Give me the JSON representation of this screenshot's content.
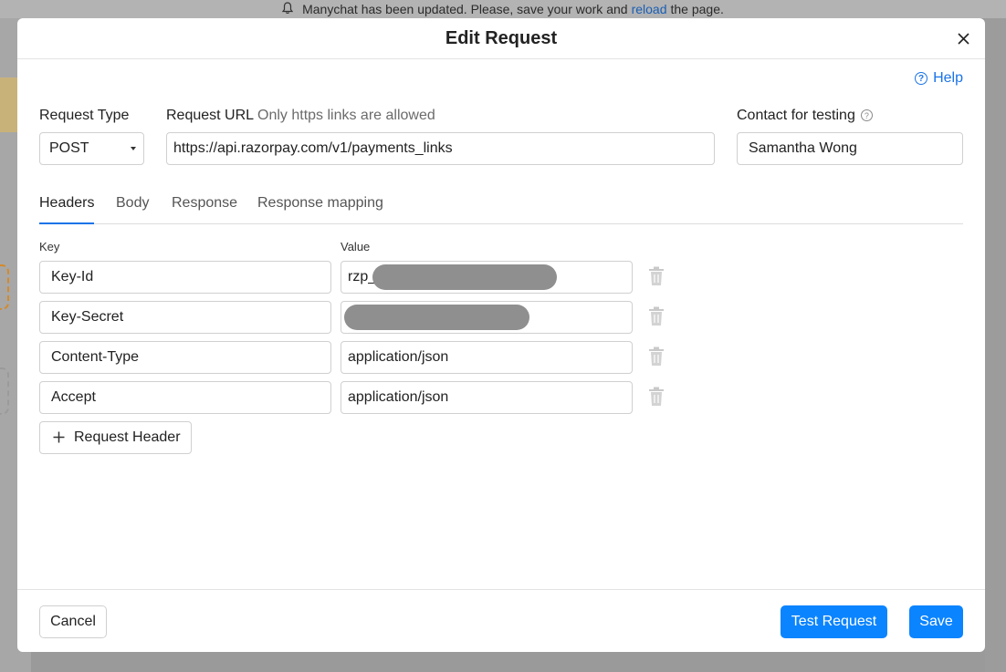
{
  "background": {
    "banner": {
      "text_before": "Manychat has been updated. Please, save your work and",
      "link": "reload",
      "text_after": "the page."
    }
  },
  "modal": {
    "title": "Edit Request",
    "help_label": "Help",
    "request_type": {
      "label": "Request Type",
      "value": "POST"
    },
    "request_url": {
      "label": "Request URL",
      "hint": "Only https links are allowed",
      "value": "https://api.razorpay.com/v1/payments_links"
    },
    "contact": {
      "label": "Contact for testing",
      "value": "Samantha Wong"
    },
    "tabs": [
      {
        "label": "Headers",
        "active": true
      },
      {
        "label": "Body",
        "active": false
      },
      {
        "label": "Response",
        "active": false
      },
      {
        "label": "Response mapping",
        "active": false
      }
    ],
    "headers_table": {
      "key_label": "Key",
      "value_label": "Value",
      "rows": [
        {
          "key": "Key-Id",
          "value": "rzp_",
          "redacted": true
        },
        {
          "key": "Key-Secret",
          "value": "",
          "redacted": true
        },
        {
          "key": "Content-Type",
          "value": "application/json",
          "redacted": false
        },
        {
          "key": "Accept",
          "value": "application/json",
          "redacted": false
        }
      ],
      "add_label": "Request Header"
    },
    "footer": {
      "cancel_label": "Cancel",
      "test_label": "Test Request",
      "save_label": "Save"
    }
  },
  "colors": {
    "accent": "#0b84ff",
    "link": "#1a73e8",
    "redaction": "#8f8f8f"
  }
}
